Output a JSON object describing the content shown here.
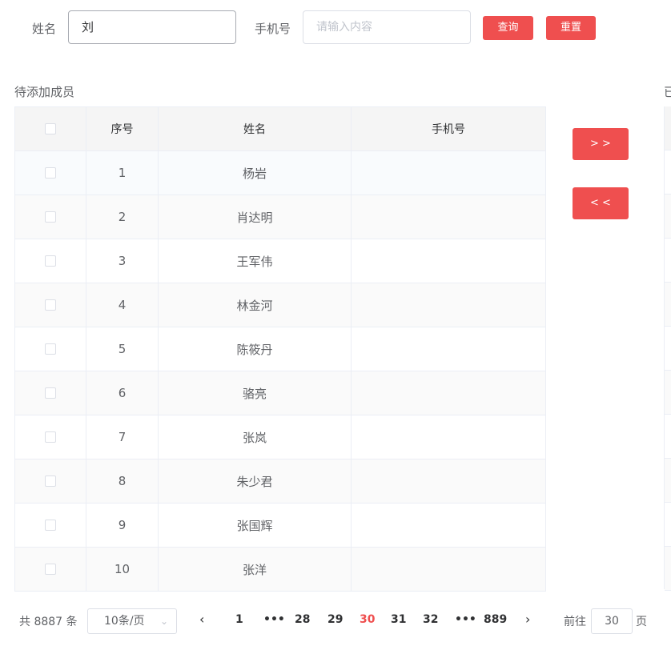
{
  "search": {
    "name_label": "姓名",
    "name_value": "刘",
    "phone_label": "手机号",
    "phone_placeholder": "请输入内容",
    "search_button": "查询",
    "reset_button": "重置"
  },
  "left_panel": {
    "title": "待添加成员",
    "columns": {
      "index": "序号",
      "name": "姓名",
      "phone": "手机号"
    },
    "rows": [
      {
        "index": "1",
        "name": "杨岩",
        "phone": ""
      },
      {
        "index": "2",
        "name": "肖达明",
        "phone": ""
      },
      {
        "index": "3",
        "name": "王军伟",
        "phone": ""
      },
      {
        "index": "4",
        "name": "林金河",
        "phone": ""
      },
      {
        "index": "5",
        "name": "陈筱丹",
        "phone": ""
      },
      {
        "index": "6",
        "name": "骆亮",
        "phone": ""
      },
      {
        "index": "7",
        "name": "张岚",
        "phone": ""
      },
      {
        "index": "8",
        "name": "朱少君",
        "phone": ""
      },
      {
        "index": "9",
        "name": "张国辉",
        "phone": ""
      },
      {
        "index": "10",
        "name": "张洋",
        "phone": ""
      }
    ]
  },
  "right_panel": {
    "title": "已"
  },
  "transfer": {
    "to_right": "> >",
    "to_left": "< <"
  },
  "pagination": {
    "total": "共 8887 条",
    "page_size": "10条/页",
    "pages": [
      "1",
      "•••",
      "28",
      "29",
      "30",
      "31",
      "32",
      "•••",
      "889"
    ],
    "current": "30",
    "goto_label": "前往",
    "goto_value": "30",
    "goto_suffix": "页"
  },
  "colors": {
    "accent": "#ef4f4f",
    "border": "#ebeef5",
    "header_bg": "#f5f5f5"
  }
}
